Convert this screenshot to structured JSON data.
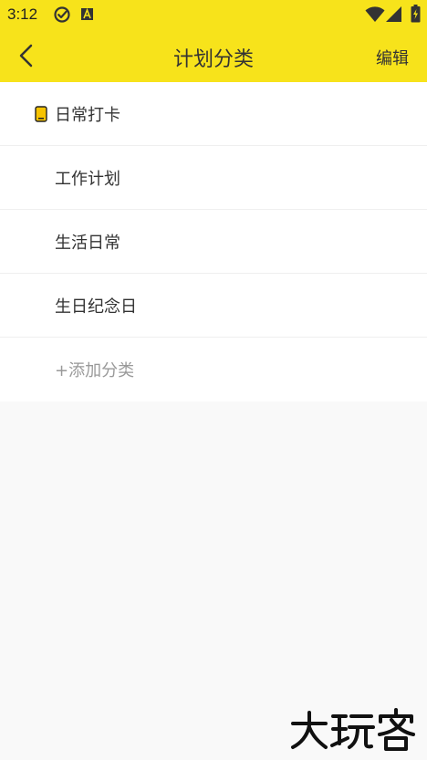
{
  "status_bar": {
    "time": "3:12",
    "icons": [
      "check-circle-icon",
      "a-notification-icon",
      "wifi-icon",
      "signal-icon",
      "battery-icon"
    ]
  },
  "toolbar": {
    "back_icon": "chevron-left-icon",
    "title": "计划分类",
    "edit_label": "编辑"
  },
  "categories": [
    {
      "label": "日常打卡",
      "selected": true,
      "icon": "phone-small-icon"
    },
    {
      "label": "工作计划",
      "selected": false
    },
    {
      "label": "生活日常",
      "selected": false
    },
    {
      "label": "生日纪念日",
      "selected": false
    }
  ],
  "add_category_label": "+添加分类",
  "watermark_text": "大玩客",
  "colors": {
    "accent": "#f7e31b",
    "background": "#f9f9f9",
    "item_background": "#ffffff",
    "text_primary": "#333333",
    "text_secondary": "#999999",
    "icon_fill": "#f7c300"
  }
}
